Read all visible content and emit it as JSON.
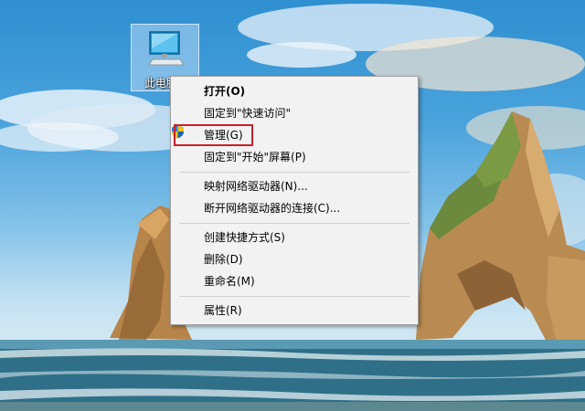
{
  "desktop": {
    "icons": [
      {
        "label": "此电脑",
        "icon": "computer-icon"
      }
    ]
  },
  "context_menu": {
    "items": [
      {
        "label": "打开(O)",
        "bold": true
      },
      {
        "label": "固定到\"快速访问\""
      },
      {
        "label": "管理(G)",
        "icon": "uac-shield-icon",
        "highlighted": true
      },
      {
        "label": "固定到\"开始\"屏幕(P)"
      },
      {
        "label": "映射网络驱动器(N)..."
      },
      {
        "label": "断开网络驱动器的连接(C)..."
      },
      {
        "label": "创建快捷方式(S)"
      },
      {
        "label": "删除(D)"
      },
      {
        "label": "重命名(M)"
      },
      {
        "label": "属性(R)"
      }
    ],
    "highlight_color": "#c9202a"
  }
}
